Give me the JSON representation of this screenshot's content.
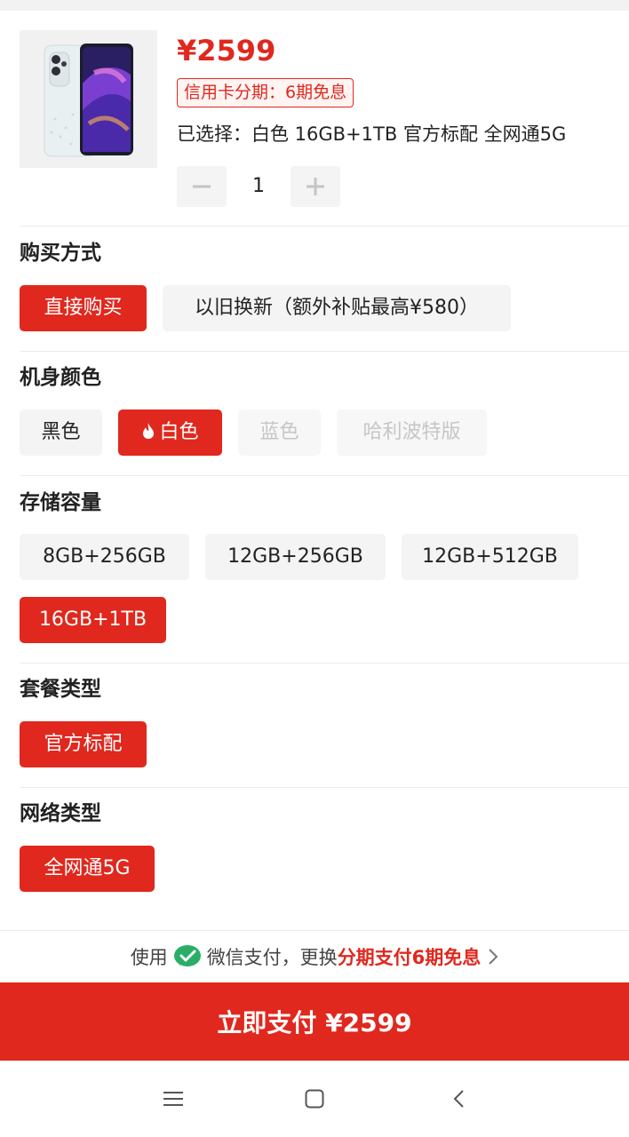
{
  "product": {
    "price": "¥2599",
    "installment_badge": "信用卡分期：6期免息",
    "selected_text": "已选择：白色 16GB+1TB 官方标配 全网通5G",
    "quantity": "1"
  },
  "sections": {
    "purchase": {
      "title": "购买方式",
      "options": [
        "直接购买",
        "以旧换新（额外补贴最高¥580）"
      ]
    },
    "color": {
      "title": "机身颜色",
      "options": [
        "黑色",
        "白色",
        "蓝色",
        "哈利波特版"
      ]
    },
    "storage": {
      "title": "存储容量",
      "options": [
        "8GB+256GB",
        "12GB+256GB",
        "12GB+512GB",
        "16GB+1TB"
      ]
    },
    "package": {
      "title": "套餐类型",
      "options": [
        "官方标配"
      ]
    },
    "network": {
      "title": "网络类型",
      "options": [
        "全网通5G"
      ]
    }
  },
  "payment": {
    "prefix": "使用",
    "method": "微信支付，更换",
    "promo": "分期支付6期免息",
    "button": "立即支付 ¥2599"
  },
  "colors": {
    "accent": "#e0281e",
    "wechat_green": "#2aae67"
  },
  "icons": [
    "minus-icon",
    "plus-icon",
    "flame-icon",
    "wechat-pay-icon",
    "chevron-right-icon",
    "menu-icon",
    "home-square-icon",
    "back-icon"
  ]
}
